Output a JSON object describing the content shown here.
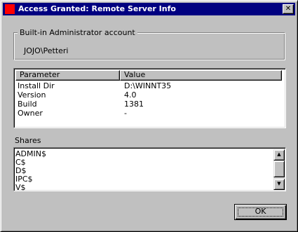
{
  "window": {
    "title": "Access Granted: Remote Server Info",
    "close_glyph": "✕",
    "title_icon": "app-icon",
    "title_color": "#000080"
  },
  "admin_group": {
    "legend": "Built-in Administrator account",
    "value": "JOJO\\Petteri"
  },
  "params_table": {
    "columns": [
      "Parameter",
      "Value"
    ],
    "rows": [
      {
        "param": "Install Dir",
        "value": "D:\\WINNT35"
      },
      {
        "param": "Version",
        "value": "4.0"
      },
      {
        "param": "Build",
        "value": "1381"
      },
      {
        "param": "Owner",
        "value": "-"
      }
    ]
  },
  "shares": {
    "label": "Shares",
    "items": [
      "ADMIN$",
      "C$",
      "D$",
      "IPC$",
      "V$"
    ],
    "scroll_up_glyph": "▲",
    "scroll_down_glyph": "▼"
  },
  "buttons": {
    "ok_label": "OK"
  }
}
